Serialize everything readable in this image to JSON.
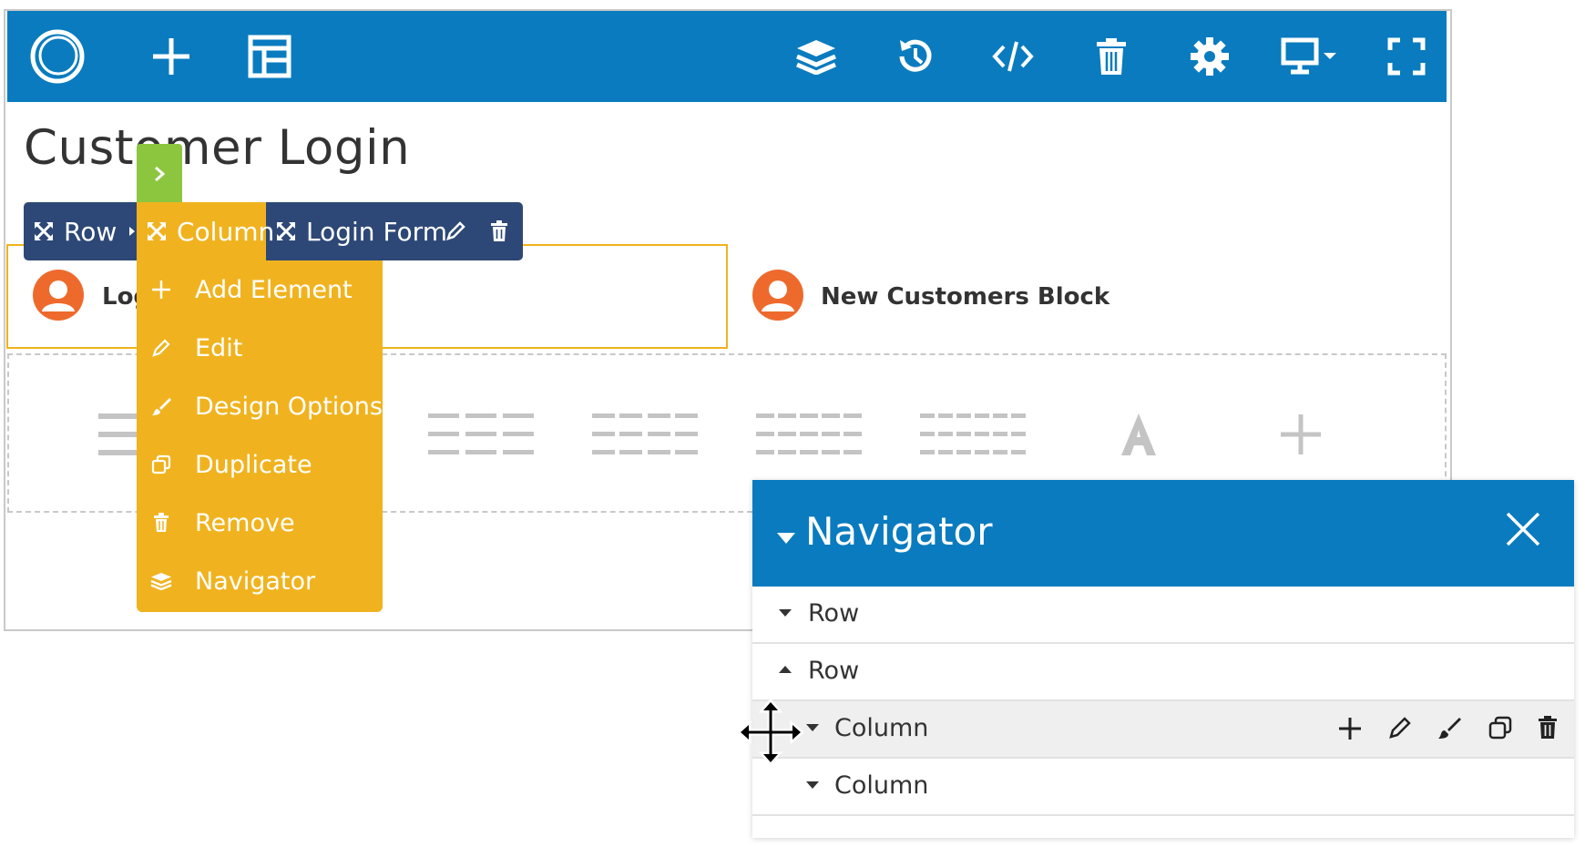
{
  "toolbar": {
    "icons": [
      "logo-icon",
      "plus-icon",
      "layout-icon",
      "layers-icon",
      "history-icon",
      "code-icon",
      "trash-icon",
      "gear-icon",
      "desktop-icon",
      "fullscreen-icon"
    ],
    "color": "#0a7bbf"
  },
  "page": {
    "title": "Customer Login"
  },
  "breadcrumb": {
    "row_label": "Row",
    "column_label": "Column",
    "element_label": "Login Form",
    "bar_color": "#2d4876",
    "active_color": "#f0b31f"
  },
  "blocks": {
    "left_label": "Log",
    "right_label": "New Customers Block"
  },
  "context_menu": {
    "items": [
      {
        "label": "Add Element",
        "icon": "plus-icon"
      },
      {
        "label": "Edit",
        "icon": "pencil-icon"
      },
      {
        "label": "Design Options",
        "icon": "brush-icon"
      },
      {
        "label": "Duplicate",
        "icon": "duplicate-icon"
      },
      {
        "label": "Remove",
        "icon": "trash-icon"
      },
      {
        "label": "Navigator",
        "icon": "layers-icon"
      }
    ]
  },
  "layout_picker": {
    "icons": [
      "one-column-icon",
      "three-column-icon",
      "four-column-icon",
      "five-column-icon",
      "six-column-icon",
      "text-block-icon",
      "add-icon"
    ]
  },
  "navigator": {
    "title": "Navigator",
    "rows": [
      {
        "label": "Row",
        "expanded": false
      },
      {
        "label": "Row",
        "expanded": true
      },
      {
        "label": "Column",
        "expanded": false,
        "active": true
      },
      {
        "label": "Column",
        "expanded": false
      }
    ],
    "row_tools": [
      "plus-icon",
      "pencil-icon",
      "brush-icon",
      "duplicate-icon",
      "trash-icon"
    ]
  }
}
